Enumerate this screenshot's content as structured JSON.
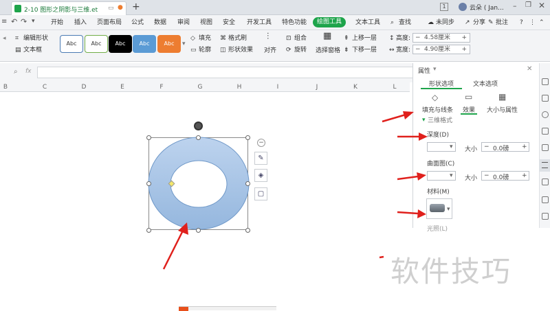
{
  "titlebar": {
    "doc_title": "2-10 图形之阴影与三维.et",
    "user_name": "云朵 ( Jan...",
    "page_badge": "1"
  },
  "ribbon": {
    "tabs": [
      "开始",
      "插入",
      "页面布局",
      "公式",
      "数据",
      "审阅",
      "视图",
      "安全",
      "开发工具",
      "特色功能",
      "绘图工具",
      "文本工具"
    ],
    "active_tab": "绘图工具",
    "search_label": "查找",
    "sync_label": "未同步",
    "share_label": "分享",
    "comment_label": "批注"
  },
  "toolbar": {
    "edit_shape": "编辑形状",
    "text_box": "文本框",
    "style_sample": "Abc",
    "fill": "填充",
    "format_brush": "格式刷",
    "outline": "轮廓",
    "shape_effect": "形状效果",
    "align": "对齐",
    "group": "组合",
    "rotate": "旋转",
    "select_pane": "选择窗格",
    "bring_forward": "上移一层",
    "send_backward": "下移一层",
    "height_label": "高度:",
    "height_value": "4.58厘米",
    "width_label": "宽度:",
    "width_value": "4.90厘米",
    "style_colors": [
      "#ffffff",
      "#ffffff",
      "#000000",
      "#5b9bd5",
      "#ed7d31"
    ],
    "style_borders": [
      "#4a7ab3",
      "#70ad47",
      "#000000",
      "#5b9bd5",
      "#ed7d31"
    ]
  },
  "formula_bar": {
    "fx": "fx",
    "value": ""
  },
  "columns": [
    "B",
    "C",
    "D",
    "E",
    "F",
    "G",
    "H",
    "I",
    "J",
    "K",
    "L"
  ],
  "panel": {
    "title": "属性",
    "tab_shape": "形状选项",
    "tab_text": "文本选项",
    "sub_fill": "填充与线条",
    "sub_effect": "效果",
    "sub_size": "大小与属性",
    "section": "三维格式",
    "depth_label": "深度(D)",
    "size_label": "大小",
    "depth_value": "0.0磅",
    "contour_label": "曲面图(C)",
    "contour_value": "0.0磅",
    "material_label": "材料(M)",
    "lighting_label": "光照(L)"
  },
  "watermark": "软件技巧",
  "colors": {
    "accent_green": "#1ea44b",
    "shape_fill": "#a9c6e8",
    "shape_stroke": "#6f98c8",
    "arrow_red": "#e0201c"
  }
}
